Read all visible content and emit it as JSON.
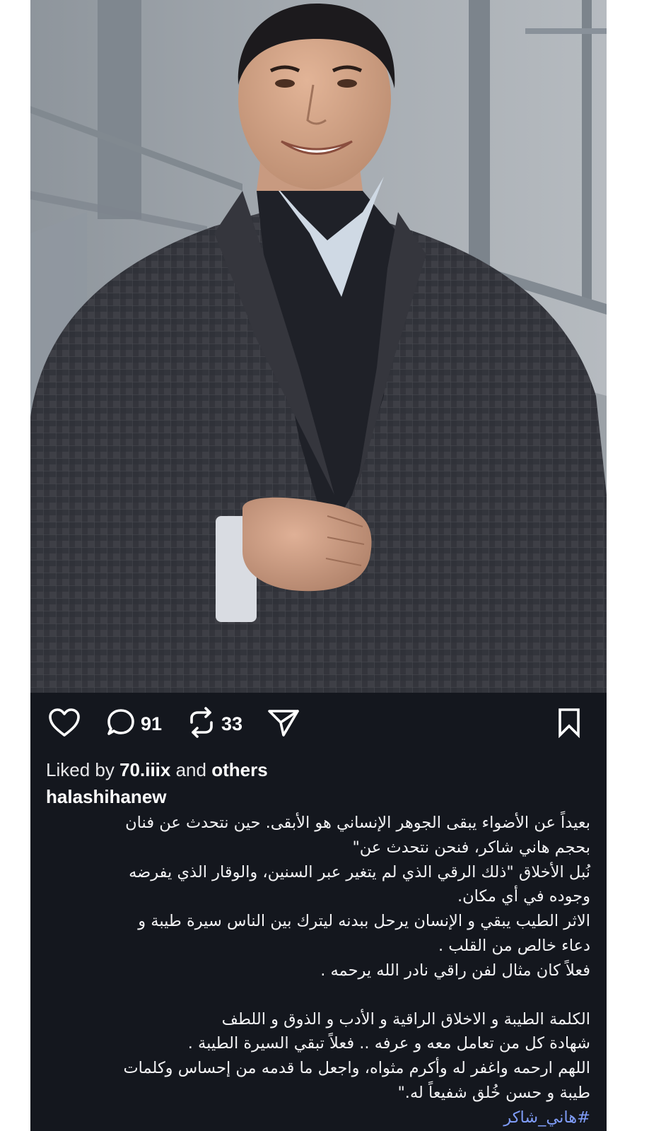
{
  "post": {
    "username": "halashihanew",
    "liked_by": {
      "prefix": "Liked by",
      "user": "70.iiix",
      "conj": "and",
      "others": "others"
    },
    "actions": {
      "like_icon": "heart-icon",
      "comment_icon": "comment-icon",
      "comment_count": "91",
      "repost_icon": "repost-icon",
      "repost_count": "33",
      "share_icon": "send-icon",
      "save_icon": "bookmark-icon"
    },
    "caption_lines": [
      "بعيداً عن الأضواء يبقى الجوهر الإنساني هو الأبقى. حين نتحدث عن فنان",
      "بحجم هاني شاكر، فنحن نتحدث عن\"",
      "نُبل  الأخلاق \"ذلك الرقي الذي لم يتغير عبر السنين، والوقار الذي يفرضه",
      "وجوده في أي مكان.",
      "الاثر  الطيب يبقي و الإنسان يرحل ببدنه ليترك بين الناس سيرة طيبة و",
      "دعاء خالص من القلب .",
      "فعلاً كان مثال لفن راقي نادر  الله يرحمه .",
      "",
      "الكلمة الطيبة و الاخلاق الراقية و الأدب  و الذوق  و اللطف",
      "شهادة كل من تعامل معه و عرفه .. فعلاً تبقي السيرة الطيبة .",
      "اللهم ارحمه واغفر له وأكرم مثواه، واجعل ما قدمه من إحساس وكلمات",
      "طيبة  و حسن خُلق شفيعاً له.\""
    ],
    "hashtag": "#هاني_شاكر"
  },
  "colors": {
    "background": "#14171e",
    "text": "#ffffff",
    "hashtag": "#7f9cf7"
  },
  "photo": {
    "subject": "man in checked grey blazer smiling in front of concrete wall"
  }
}
